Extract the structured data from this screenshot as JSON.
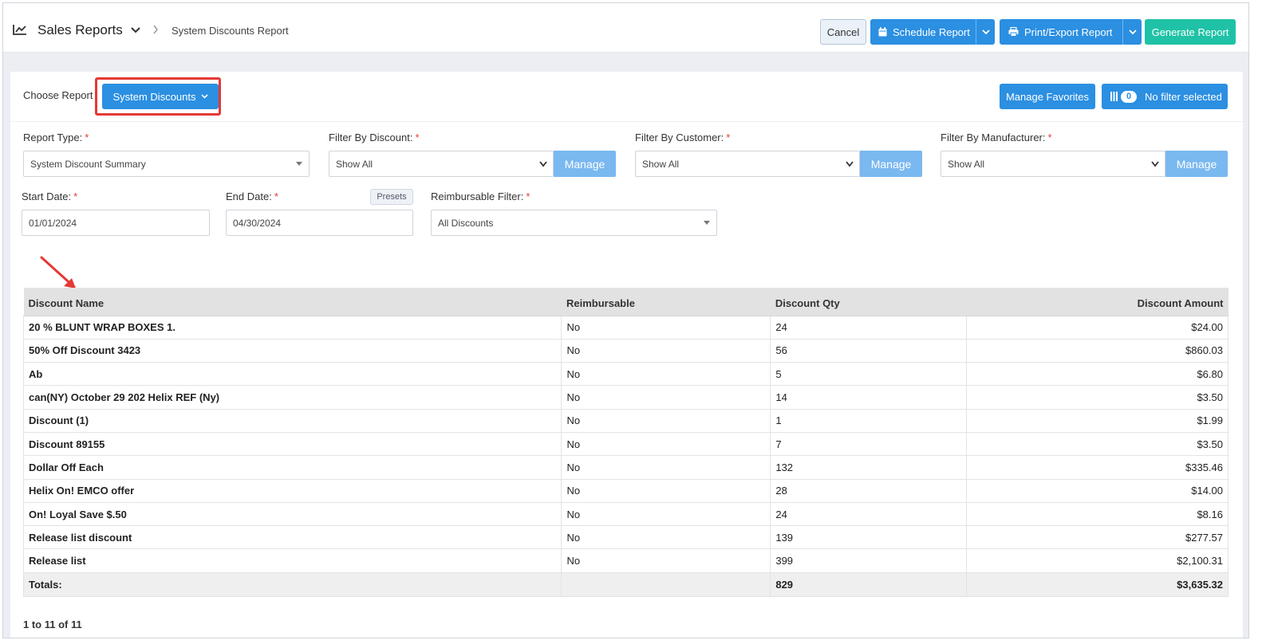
{
  "header": {
    "app_title": "Sales Reports",
    "breadcrumb": "System Discounts Report",
    "cancel_label": "Cancel",
    "schedule_label": "Schedule Report",
    "print_label": "Print/Export Report",
    "generate_label": "Generate Report"
  },
  "choose": {
    "label": "Choose Report",
    "report_button": "System Discounts",
    "manage_favorites": "Manage Favorites",
    "filter_count": "0",
    "filter_label": "No filter selected"
  },
  "filters": {
    "report_type_label": "Report Type:",
    "report_type_value": "System Discount Summary",
    "discount_label": "Filter By Discount:",
    "discount_value": "Show All",
    "customer_label": "Filter By Customer:",
    "customer_value": "Show All",
    "manufacturer_label": "Filter By Manufacturer:",
    "manufacturer_value": "Show All",
    "manage_label": "Manage",
    "start_label": "Start Date:",
    "start_value": "01/01/2024",
    "end_label": "End Date:",
    "end_value": "04/30/2024",
    "presets_label": "Presets",
    "reimb_label": "Reimbursable Filter:",
    "reimb_value": "All Discounts",
    "required_mark": "*"
  },
  "table": {
    "columns": [
      "Discount Name",
      "Reimbursable",
      "Discount Qty",
      "Discount Amount"
    ],
    "rows": [
      [
        "20 % BLUNT WRAP BOXES 1.",
        "No",
        "24",
        "$24.00"
      ],
      [
        "50% Off Discount 3423",
        "No",
        "56",
        "$860.03"
      ],
      [
        "Ab",
        "No",
        "5",
        "$6.80"
      ],
      [
        "can(NY) October 29 202 Helix REF (Ny)",
        "No",
        "14",
        "$3.50"
      ],
      [
        "Discount (1)",
        "No",
        "1",
        "$1.99"
      ],
      [
        "Discount 89155",
        "No",
        "7",
        "$3.50"
      ],
      [
        "Dollar Off Each",
        "No",
        "132",
        "$335.46"
      ],
      [
        "Helix On! EMCO offer",
        "No",
        "28",
        "$14.00"
      ],
      [
        "On! Loyal Save $.50",
        "No",
        "24",
        "$8.16"
      ],
      [
        "Release list discount",
        "No",
        "139",
        "$277.57"
      ],
      [
        "Release list",
        "No",
        "399",
        "$2,100.31"
      ]
    ],
    "totals": [
      "Totals:",
      "",
      "829",
      "$3,635.32"
    ]
  },
  "pager": "1 to 11 of 11",
  "colors": {
    "primary": "#2b8fe2",
    "teal": "#1fc2a6",
    "manage": "#7ab8f0",
    "highlight": "#e53935"
  }
}
